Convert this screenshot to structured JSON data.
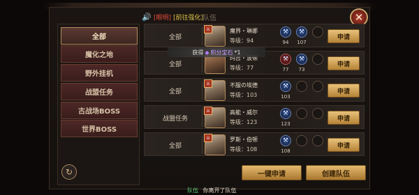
{
  "header": {
    "speaker_icon": "speaker-icon",
    "notice_red": "[眼明]",
    "notice_link": "[前往强化]",
    "title": "队伍",
    "close_icon": "close-x-icon"
  },
  "sidebar": {
    "items": [
      {
        "label": "全部",
        "active": true
      },
      {
        "label": "魔化之地",
        "active": false
      },
      {
        "label": "野外挂机",
        "active": false
      },
      {
        "label": "战盟任务",
        "active": false
      },
      {
        "label": "古战场BOSS",
        "active": false
      },
      {
        "label": "世界BOSS",
        "active": false
      }
    ],
    "refresh_icon": "refresh-icon"
  },
  "teams": [
    {
      "task": "全部",
      "name": "魔界・琳娜",
      "level": "等级：94",
      "s1": "94",
      "s2": "107",
      "avatar": "a",
      "apply": "申请"
    },
    {
      "task": "全部",
      "name": "玛吉・波顿",
      "level": "等级：77",
      "s1": "77",
      "s2": "73",
      "avatar": "b",
      "apply": "申请"
    },
    {
      "task": "全部",
      "name": "不服の埃德",
      "level": "等级：103",
      "s1": "103",
      "s2": "",
      "avatar": "a",
      "apply": "申请"
    },
    {
      "task": "战盟任务",
      "name": "高能・威尔",
      "level": "等级：123",
      "s1": "123",
      "s2": "",
      "avatar": "a",
      "apply": "申请"
    },
    {
      "task": "全部",
      "name": "罗斯・伯顿",
      "level": "等级：108",
      "s1": "108",
      "s2": "",
      "avatar": "a",
      "apply": "申请"
    }
  ],
  "toast": {
    "get": "获得",
    "item": "积分宝石",
    "count": "*1"
  },
  "buttons": {
    "one_click": "一键申请",
    "create": "创建队伍"
  },
  "chat": {
    "channel": "队伍",
    "message": "你离开了队伍"
  }
}
